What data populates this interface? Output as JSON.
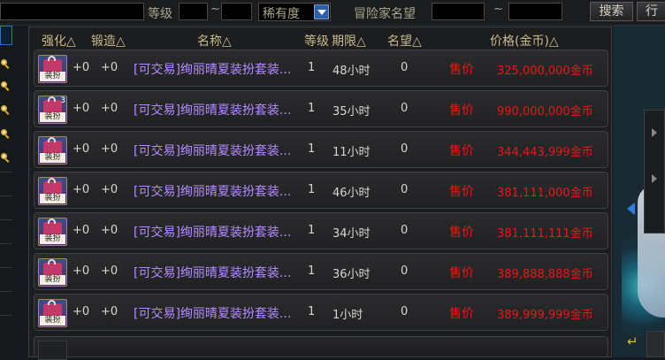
{
  "filter_bar": {
    "level_label": "等级",
    "tilde": "~",
    "rarity_value": "稀有度",
    "reputation_label": "冒险家名望",
    "search_label": "搜索",
    "sort_label": "行"
  },
  "columns": {
    "enhance": "强化△",
    "forge": "锻造△",
    "name": "名称△",
    "level": "等级",
    "time_limit": "期限△",
    "reputation": "名望△",
    "price": "价格(金币)△"
  },
  "rows": [
    {
      "enhance": "+0",
      "forge": "+0",
      "name": "[可交易]绚丽晴夏装扮套装...",
      "level": "1",
      "time_limit": "48小时",
      "reputation": "0",
      "sale_label": "售价",
      "price": "325,000,000金币",
      "icon_tag": "装扮",
      "icon_qty": ""
    },
    {
      "enhance": "+0",
      "forge": "+0",
      "name": "[可交易]绚丽晴夏装扮套装...",
      "level": "1",
      "time_limit": "35小时",
      "reputation": "0",
      "sale_label": "售价",
      "price": "990,000,000金币",
      "icon_tag": "装扮",
      "icon_qty": "3"
    },
    {
      "enhance": "+0",
      "forge": "+0",
      "name": "[可交易]绚丽晴夏装扮套装...",
      "level": "1",
      "time_limit": "11小时",
      "reputation": "0",
      "sale_label": "售价",
      "price": "344,443,999金币",
      "icon_tag": "装扮",
      "icon_qty": ""
    },
    {
      "enhance": "+0",
      "forge": "+0",
      "name": "[可交易]绚丽晴夏装扮套装...",
      "level": "1",
      "time_limit": "46小时",
      "reputation": "0",
      "sale_label": "售价",
      "price": "381,111,000金币",
      "icon_tag": "装扮",
      "icon_qty": ""
    },
    {
      "enhance": "+0",
      "forge": "+0",
      "name": "[可交易]绚丽晴夏装扮套装...",
      "level": "1",
      "time_limit": "34小时",
      "reputation": "0",
      "sale_label": "售价",
      "price": "381,111,111金币",
      "icon_tag": "装扮",
      "icon_qty": ""
    },
    {
      "enhance": "+0",
      "forge": "+0",
      "name": "[可交易]绚丽晴夏装扮套装...",
      "level": "1",
      "time_limit": "36小时",
      "reputation": "0",
      "sale_label": "售价",
      "price": "389,888,888金币",
      "icon_tag": "装扮",
      "icon_qty": ""
    },
    {
      "enhance": "+0",
      "forge": "+0",
      "name": "[可交易]绚丽晴夏装扮套装...",
      "level": "1",
      "time_limit": "1小时",
      "reputation": "0",
      "sale_label": "售价",
      "price": "389,999,999金币",
      "icon_tag": "装扮",
      "icon_qty": ""
    }
  ],
  "right_panel": {
    "back_glyph": "↵"
  },
  "colors": {
    "item_name": "#b58bff",
    "price": "#e21b1b",
    "header": "#c9b98e",
    "accent_blue": "#2d5fa8"
  }
}
